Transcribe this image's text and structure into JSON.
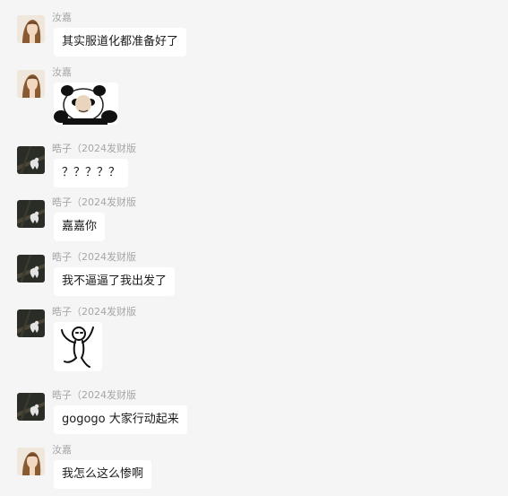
{
  "messages": [
    {
      "sender": "汝嘉",
      "type": "text",
      "text": "其实服道化都准备好了"
    },
    {
      "sender": "汝嘉",
      "type": "sticker",
      "sticker": "panda-meme-sticker"
    },
    {
      "sender": "晧子（2024发财版",
      "type": "text",
      "text": "？？？？？"
    },
    {
      "sender": "晧子（2024发财版",
      "type": "text",
      "text": "嘉嘉你"
    },
    {
      "sender": "晧子（2024发财版",
      "type": "text",
      "text": "我不逼逼了我出发了"
    },
    {
      "sender": "晧子（2024发财版",
      "type": "sticker",
      "sticker": "dancing-figure-sticker"
    },
    {
      "sender": "晧子（2024发财版",
      "type": "text",
      "text": "gogogo 大家行动起来"
    },
    {
      "sender": "汝嘉",
      "type": "text",
      "text": "我怎么这么惨啊"
    }
  ]
}
